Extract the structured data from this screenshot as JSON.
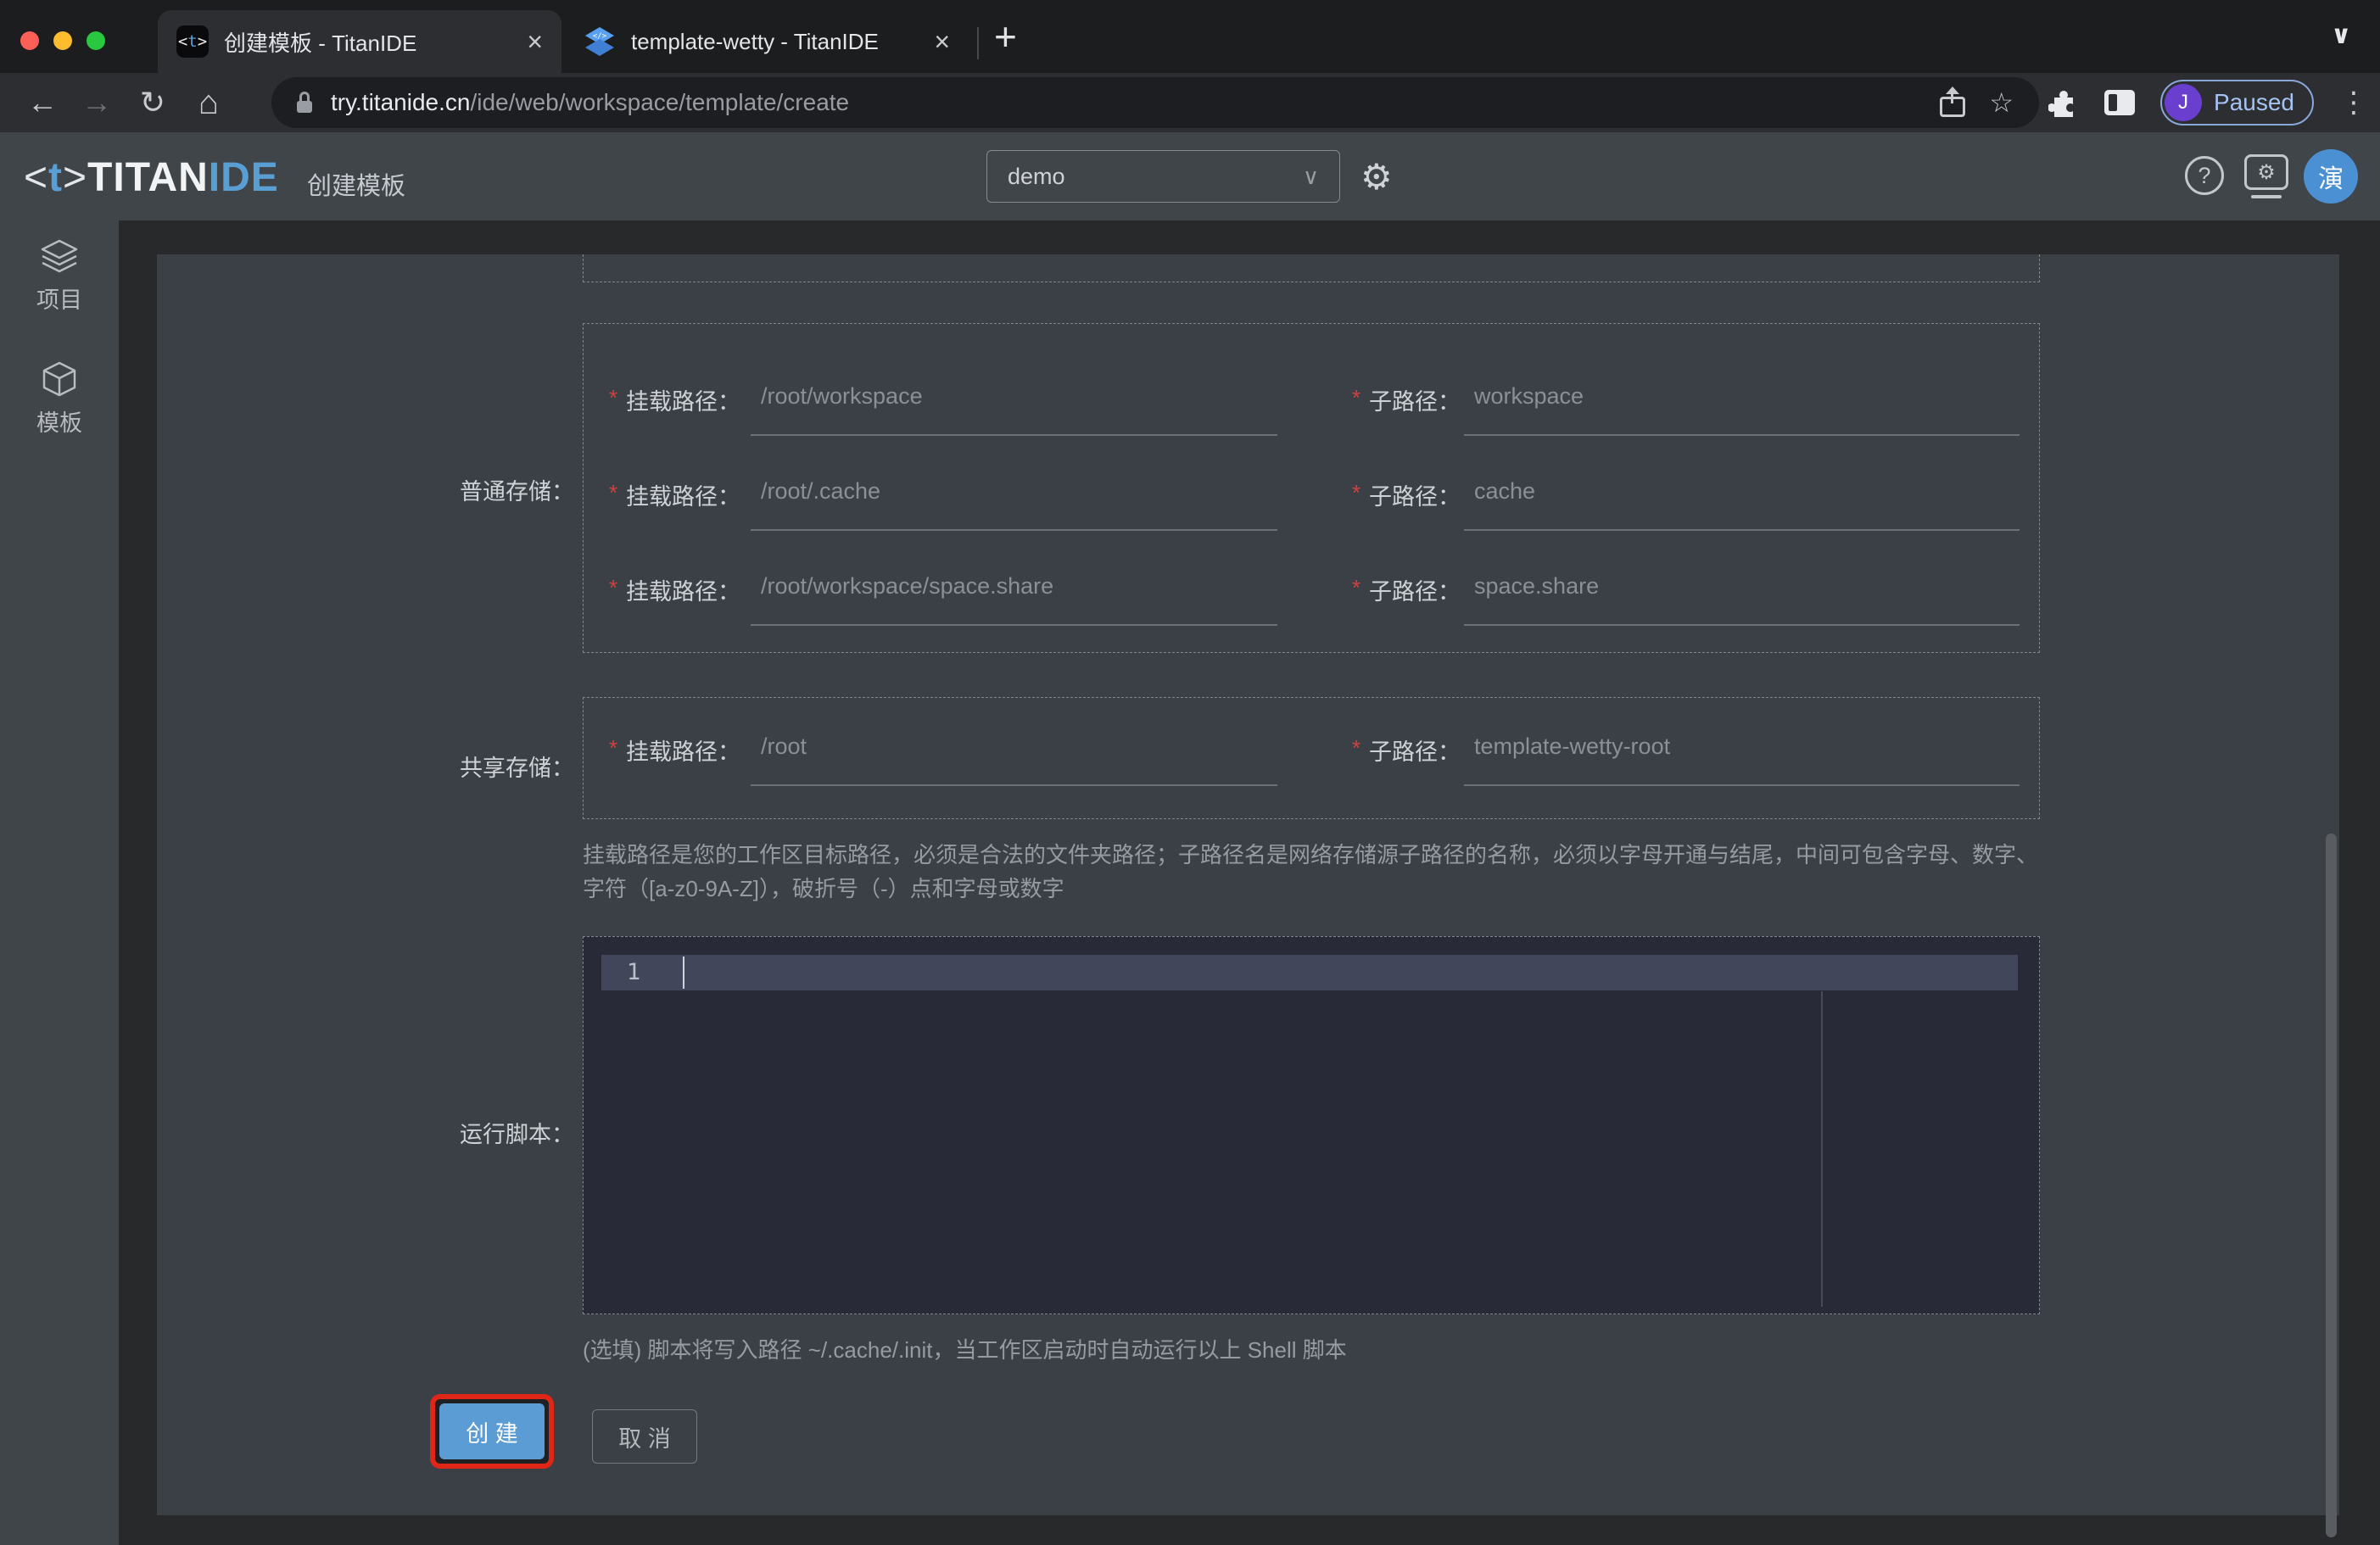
{
  "browser": {
    "tab1": {
      "title": "创建模板 - TitanIDE",
      "favicon_open": "<",
      "favicon_t": "t",
      "favicon_close": ">"
    },
    "tab2": {
      "title": "template-wetty - TitanIDE"
    },
    "url": {
      "host": "try.titanide.cn",
      "path": "/ide/web/workspace/template/create"
    },
    "profile": {
      "initial": "J",
      "status": "Paused"
    }
  },
  "icons": {
    "close": "×",
    "new_tab": "+",
    "tab_overflow": "∨",
    "back": "←",
    "forward": "→",
    "reload": "↻",
    "home": "⌂",
    "star": "☆",
    "menu": "⋮",
    "help": "?",
    "gear": "⚙",
    "select_chevron": "∨"
  },
  "header": {
    "logo_bracket_open": "<",
    "logo_t": "t",
    "logo_bracket_close": ">",
    "logo_titan": "TITAN",
    "logo_ide": "IDE",
    "page_title": "创建模板",
    "workspace": "demo",
    "avatar": "演"
  },
  "sidebar": {
    "item1": "项目",
    "item2": "模板"
  },
  "form": {
    "required": "*",
    "normal_storage_label": "普通存储：",
    "shared_storage_label": "共享存储：",
    "script_label": "运行脚本：",
    "mount_label": "挂载路径：",
    "sub_label": "子路径：",
    "rows": {
      "n1": {
        "mount": "/root/workspace",
        "sub": "workspace"
      },
      "n2": {
        "mount": "/root/.cache",
        "sub": "cache"
      },
      "n3": {
        "mount": "/root/workspace/space.share",
        "sub": "space.share"
      },
      "s1": {
        "mount": "/root",
        "sub": "template-wetty-root"
      }
    },
    "path_help": "挂载路径是您的工作区目标路径，必须是合法的文件夹路径；子路径名是网络存储源子路径的名称，必须以字母开通与结尾，中间可包含字母、数字、字符（[a-z0-9A-Z]），破折号（-）点和字母或数字",
    "editor": {
      "line_number": "1"
    },
    "script_help": "(选填) 脚本将写入路径 ~/.cache/.init，当工作区启动时自动运行以上 Shell 脚本",
    "create": "创 建",
    "cancel": "取 消"
  },
  "colors": {
    "accent_blue": "#5b9cd4",
    "highlight_red": "#e02617",
    "avatar_blue": "#4a90d2",
    "required_red": "#d0413d"
  }
}
